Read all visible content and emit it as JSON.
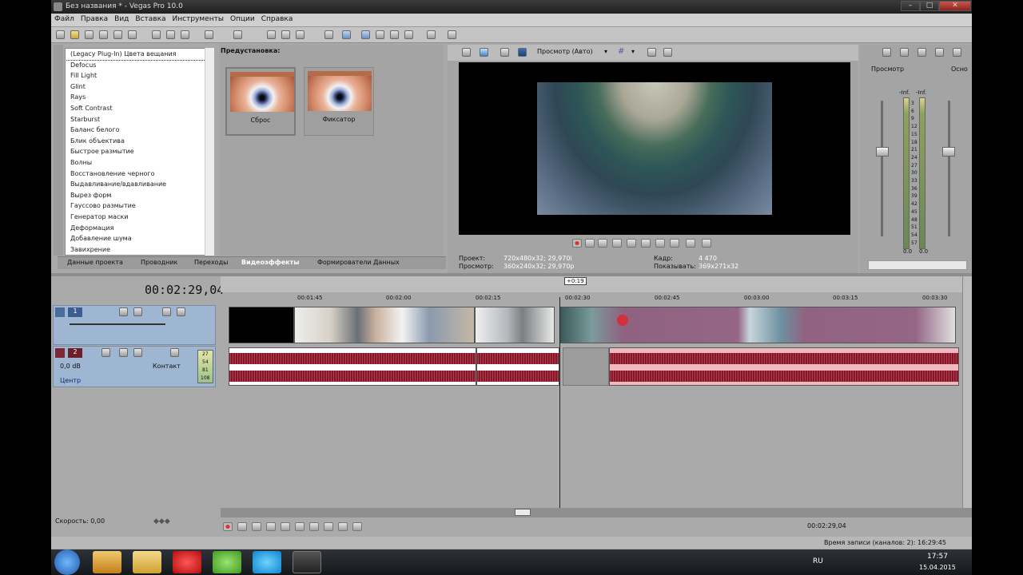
{
  "window": {
    "title": "Без названия * - Vegas Pro 10.0",
    "min": "–",
    "max": "□",
    "close": "✕"
  },
  "menu": [
    "Файл",
    "Правка",
    "Вид",
    "Вставка",
    "Инструменты",
    "Опции",
    "Справка"
  ],
  "fx_list": {
    "items": [
      "(Legacy Plug-In) Цвета вещания",
      "Defocus",
      "Fill Light",
      "Glint",
      "Rays",
      "Soft Contrast",
      "Starburst",
      "Баланс белого",
      "Блик объектива",
      "Быстрое размытие",
      "Волны",
      "Восстановление черного",
      "Выдавливание/вдавливание",
      "Вырез форм",
      "Гауссово размытие",
      "Генератор маски",
      "Деформация",
      "Добавление шума",
      "Завихрение"
    ]
  },
  "presets": {
    "header": "Предустановка:",
    "items": [
      "Сброс",
      "Фиксатор"
    ]
  },
  "tabs": [
    "Данные проекта",
    "Проводник",
    "Переходы",
    "Видеоэффекты",
    "Формирователи Данных"
  ],
  "active_tab": "Видеоэффекты",
  "preview": {
    "mode": "Просмотр (Авто)",
    "project_label": "Проект:",
    "project_value": "720x480x32; 29,970i",
    "preview_label": "Просмотр:",
    "preview_value": "360x240x32; 29,970p",
    "frame_label": "Кадр:",
    "frame_value": "4 470",
    "display_label": "Показывать:",
    "display_value": "369x271x32"
  },
  "mixer": {
    "label": "Просмотр",
    "tab": "Осно",
    "scale": [
      "3",
      "6",
      "9",
      "12",
      "15",
      "18",
      "21",
      "24",
      "27",
      "30",
      "33",
      "36",
      "39",
      "42",
      "45",
      "48",
      "51",
      "54",
      "57"
    ],
    "left_value": "0.0",
    "right_value": "0.0",
    "dash": "-Inf."
  },
  "timeline": {
    "timecode": "00:02:29,04",
    "ruler": [
      "00:01:45",
      "00:02:00",
      "00:02:15",
      "00:02:30",
      "00:02:45",
      "00:03:00",
      "00:03:15",
      "00:03:30"
    ],
    "marker": "+0:19",
    "audio_volume": "0,0 dB",
    "audio_pan": "Центр",
    "audio_fx": "Контакт",
    "meter_values": [
      "27",
      "54",
      "81",
      "108"
    ],
    "speed": "Скорость: 0,00",
    "end_time": "00:02:29,04",
    "record_time": "Время записи (каналов: 2): 16:29:45"
  },
  "taskbar": {
    "lang": "RU",
    "time": "17:57",
    "date": "15.04.2015"
  }
}
